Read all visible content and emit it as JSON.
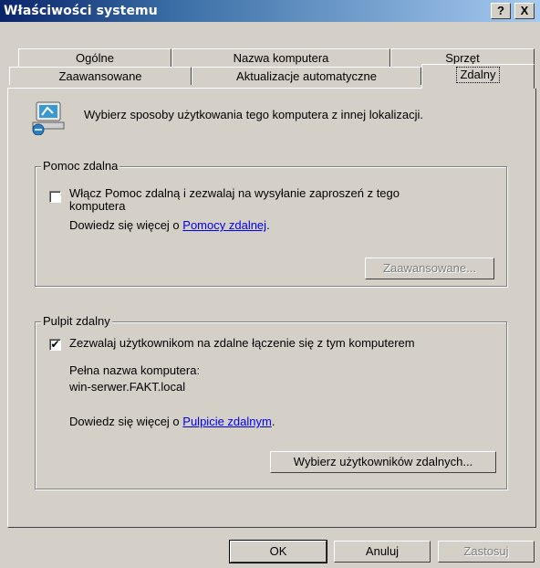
{
  "window": {
    "title": "Właściwości systemu",
    "help_btn": "?",
    "close_btn": "X"
  },
  "tabs_row1": [
    "Ogólne",
    "Nazwa komputera",
    "Sprzęt"
  ],
  "tabs_row2": [
    "Zaawansowane",
    "Aktualizacje automatyczne",
    "Zdalny"
  ],
  "intro": "Wybierz sposoby użytkowania tego komputera z innej lokalizacji.",
  "assist": {
    "legend": "Pomoc zdalna",
    "checkbox_line1": "Włącz Pomoc zdalną i zezwalaj na wysyłanie zaproszeń z tego",
    "checkbox_line2": "komputera",
    "checked": false,
    "learn_prefix": "Dowiedz się więcej o ",
    "learn_link": "Pomocy zdalnej",
    "learn_suffix": ".",
    "advanced_btn": "Zaawansowane..."
  },
  "desktop": {
    "legend": "Pulpit zdalny",
    "checkbox_label": "Zezwalaj użytkownikom na zdalne łączenie się z tym komputerem",
    "checked": true,
    "check_mark": "✔",
    "fullname_label": "Pełna nazwa komputera:",
    "fullname_value": "win-serwer.FAKT.local",
    "learn_prefix": "Dowiedz się więcej o ",
    "learn_link": "Pulpicie zdalnym",
    "learn_suffix": ".",
    "select_users_btn": "Wybierz użytkowników zdalnych..."
  },
  "buttons": {
    "ok": "OK",
    "cancel": "Anuluj",
    "apply": "Zastosuj"
  }
}
